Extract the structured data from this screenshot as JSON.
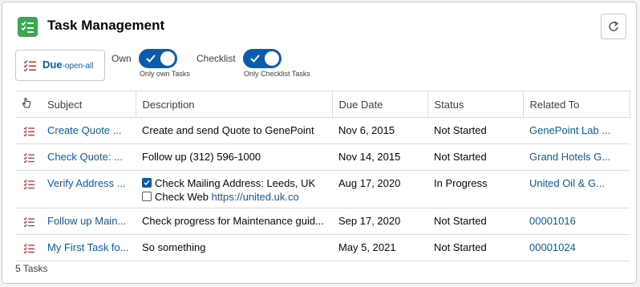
{
  "header": {
    "title": "Task Management",
    "app_icon": "checklist-icon",
    "refresh_icon": "refresh-icon"
  },
  "filter": {
    "label": "Due",
    "sub_label": "-open-all",
    "icon": "task-list-icon"
  },
  "toggles": [
    {
      "label": "Own",
      "help": "Only own Tasks",
      "on": true
    },
    {
      "label": "Checklist",
      "help": "Only Checklist Tasks",
      "on": true
    }
  ],
  "table": {
    "columns": [
      "Subject",
      "Description",
      "Due Date",
      "Status",
      "Related To"
    ],
    "rows": [
      {
        "subject": "Create Quote ...",
        "description": "Create and send Quote to GenePoint",
        "due": "Nov 6, 2015",
        "status": "Not Started",
        "related": "GenePoint Lab ..."
      },
      {
        "subject": "Check Quote: ...",
        "description": "Follow up (312) 596-1000",
        "due": "Nov 14, 2015",
        "status": "Not Started",
        "related": "Grand Hotels G..."
      },
      {
        "subject": "Verify Address ...",
        "checklist": [
          {
            "checked": true,
            "text": "Check Mailing Address: Leeds, UK",
            "link": ""
          },
          {
            "checked": false,
            "text": "Check Web ",
            "link": "https://united.uk.co"
          }
        ],
        "due": "Aug 17, 2020",
        "status": "In Progress",
        "related": "United Oil & G..."
      },
      {
        "subject": "Follow up Main...",
        "description": "Check progress for Maintenance guid...",
        "due": "Sep 17, 2020",
        "status": "Not Started",
        "related": "00001016"
      },
      {
        "subject": "My First Task fo...",
        "description": "So something",
        "due": "May 5, 2021",
        "status": "Not Started",
        "related": "00001024"
      }
    ]
  },
  "footer": {
    "count": "5 Tasks"
  },
  "colors": {
    "brand": "#0b5cab",
    "app_icon_bg": "#3ba755",
    "task_icon": "#c23934"
  }
}
